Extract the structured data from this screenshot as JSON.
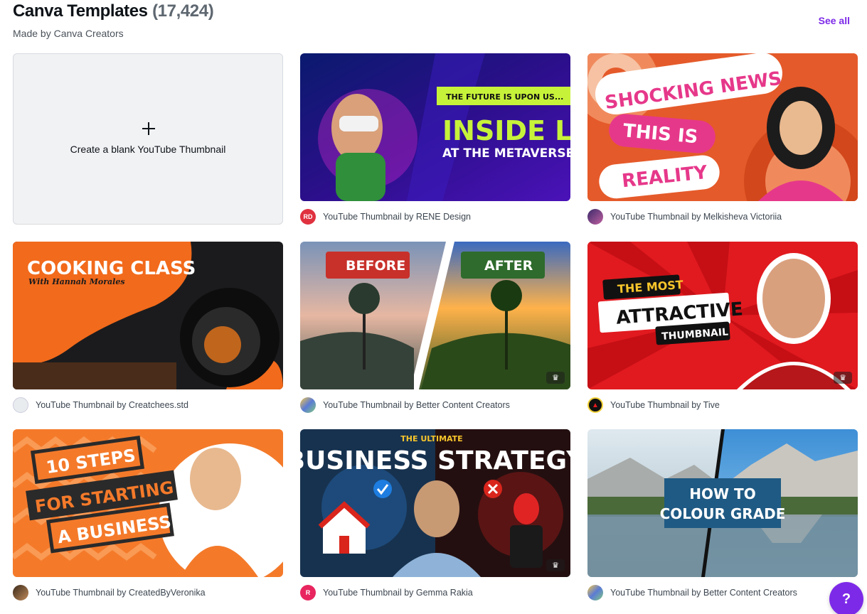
{
  "header": {
    "title": "Canva Templates",
    "count": "(17,424)",
    "subtitle": "Made by Canva Creators",
    "see_all": "See all"
  },
  "blank": {
    "label": "Create a blank YouTube Thumbnail",
    "icon": "plus-icon"
  },
  "cards": [
    {
      "caption": "YouTube Thumbnail by RENE Design",
      "avatar": "RD",
      "avatar_color": "#e0313f",
      "text": [
        "THE FUTURE IS UPON US...",
        "INSIDE LOOK",
        "AT THE METAVERSE"
      ]
    },
    {
      "caption": "YouTube Thumbnail by Melkisheva Victoriia",
      "avatar": "",
      "text": [
        "SHOCKING NEWS",
        "THIS IS",
        "REALITY"
      ]
    },
    {
      "caption": "YouTube Thumbnail by Creatchees.std",
      "avatar": "",
      "text": [
        "COOKING CLASS",
        "With Hannah Morales"
      ]
    },
    {
      "caption": "YouTube Thumbnail by Better Content Creators",
      "avatar": "",
      "text": [
        "BEFORE",
        "AFTER"
      ],
      "premium": true
    },
    {
      "caption": "YouTube Thumbnail by Tive",
      "avatar": "",
      "text": [
        "THE MOST",
        "ATTRACTIVE",
        "THUMBNAIL"
      ],
      "premium": true
    },
    {
      "caption": "YouTube Thumbnail by CreatedByVeronika",
      "avatar": "",
      "text": [
        "10 STEPS",
        "FOR STARTING",
        "A BUSINESS"
      ]
    },
    {
      "caption": "YouTube Thumbnail by Gemma Rakia",
      "avatar": "R",
      "avatar_color": "#e8255e",
      "text": [
        "THE ULTIMATE",
        "BUSINESS STRATEGY"
      ],
      "premium": true
    },
    {
      "caption": "YouTube Thumbnail by Better Content Creators",
      "avatar": "",
      "text": [
        "HOW TO",
        "COLOUR GRADE"
      ]
    }
  ],
  "help": {
    "label": "?"
  },
  "colors": {
    "accent": "#7d2ae8",
    "neon": "#c7f23a"
  }
}
